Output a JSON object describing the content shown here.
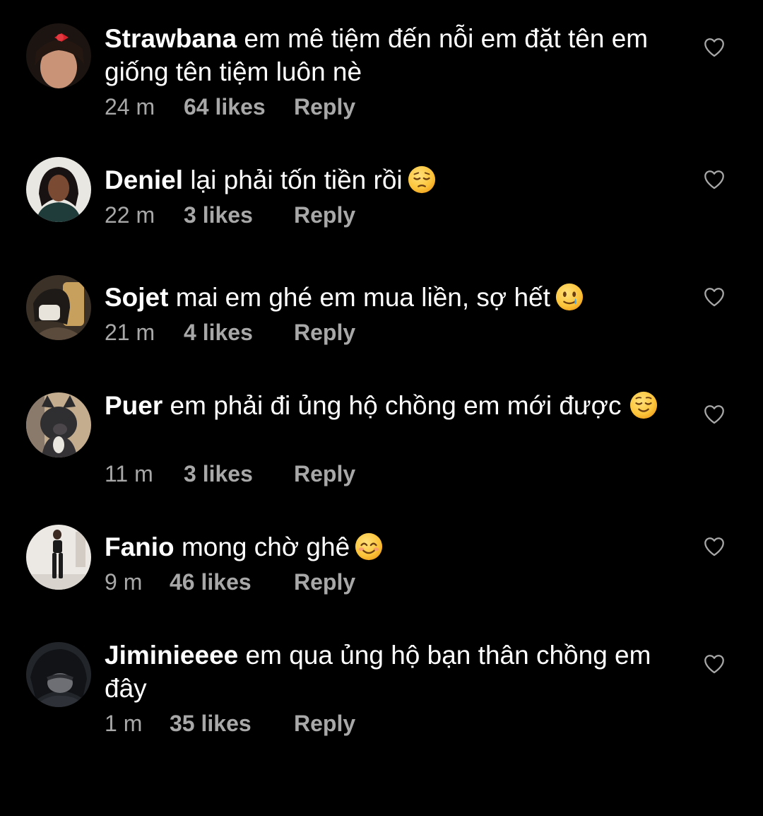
{
  "colors": {
    "background": "#000000",
    "text": "#ffffff",
    "meta": "#a8a8a8"
  },
  "comments": [
    {
      "username": "Strawbana",
      "text": "em mê tiệm đến nỗi em đặt tên em giống tên tiệm luôn nè",
      "time": "24 m",
      "likes": "64 likes",
      "reply": "Reply",
      "emoji": "",
      "like_icon": "heart-outline-icon"
    },
    {
      "username": "Deniel",
      "text": "lại phải tốn tiền rồi",
      "time": "22 m",
      "likes": "3 likes",
      "reply": "Reply",
      "emoji": "pensive-face",
      "like_icon": "heart-outline-icon"
    },
    {
      "username": "Sojet",
      "text": "mai em ghé em mua liền, sợ hết",
      "time": "21 m",
      "likes": "4 likes",
      "reply": "Reply",
      "emoji": "smiling-face-with-tear",
      "like_icon": "heart-outline-icon"
    },
    {
      "username": "Puer",
      "text": "em phải đi ủng hộ chồng em mới được",
      "time": "11 m",
      "likes": "3 likes",
      "reply": "Reply",
      "emoji": "relieved-face",
      "like_icon": "heart-outline-icon"
    },
    {
      "username": "Fanio",
      "text": "mong chờ ghê",
      "time": "9 m",
      "likes": "46 likes",
      "reply": "Reply",
      "emoji": "smiling-face-with-smiling-eyes",
      "like_icon": "heart-outline-icon"
    },
    {
      "username": "Jiminieeee",
      "text": "em qua ủng hộ bạn thân chồng em đây",
      "time": "1 m",
      "likes": "35 likes",
      "reply": "Reply",
      "emoji": "",
      "like_icon": "heart-outline-icon"
    }
  ]
}
